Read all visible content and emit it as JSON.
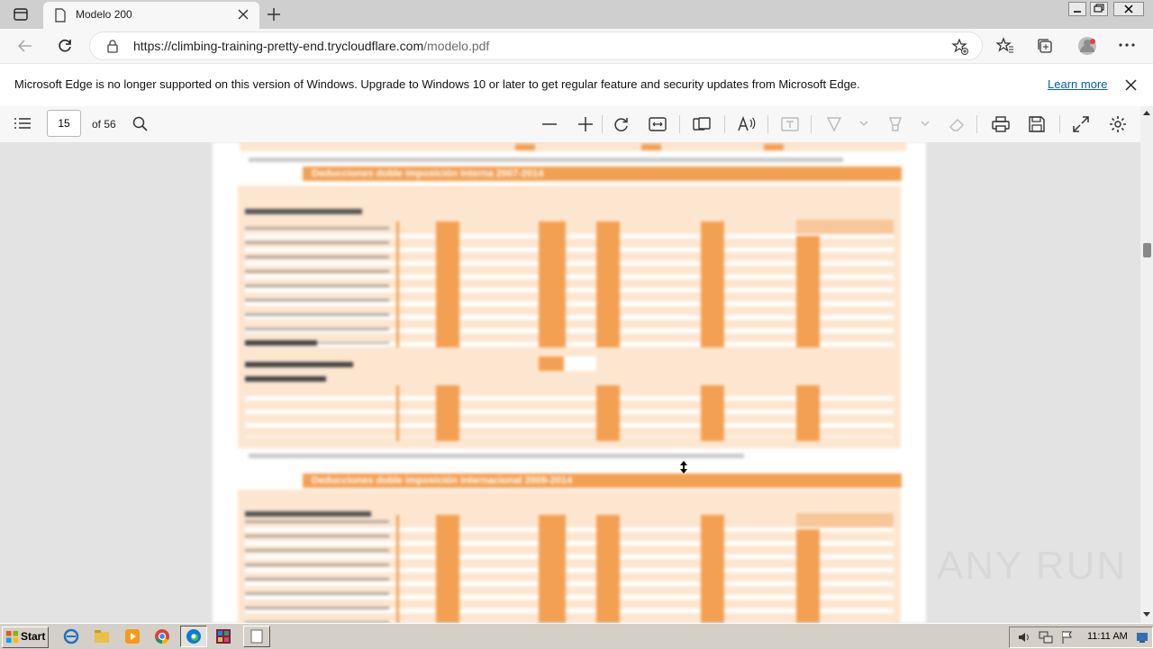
{
  "browser": {
    "tab_title": "Modelo 200",
    "url_host": "https://climbing-training-pretty-end.trycloudflare.com",
    "url_path": "/modelo.pdf"
  },
  "infobar": {
    "message": "Microsoft Edge is no longer supported on this version of Windows. Upgrade to Windows 10 or later to get regular feature and security updates from Microsoft Edge.",
    "link_label": "Learn more"
  },
  "pdf_toolbar": {
    "page_number": "15",
    "page_total": "of 56"
  },
  "document": {
    "section_1_title": "Deducciones doble imposición interna 2007-2014",
    "section_2_title": "Deducciones doble imposición internacional 2009-2014"
  },
  "taskbar": {
    "start_label": "Start",
    "clock": "11:11 AM"
  },
  "watermark": "ANY RUN",
  "colors": {
    "accent_orange": "#f4a052",
    "light_orange": "#fde6d0",
    "link_blue": "#0b5cad"
  }
}
